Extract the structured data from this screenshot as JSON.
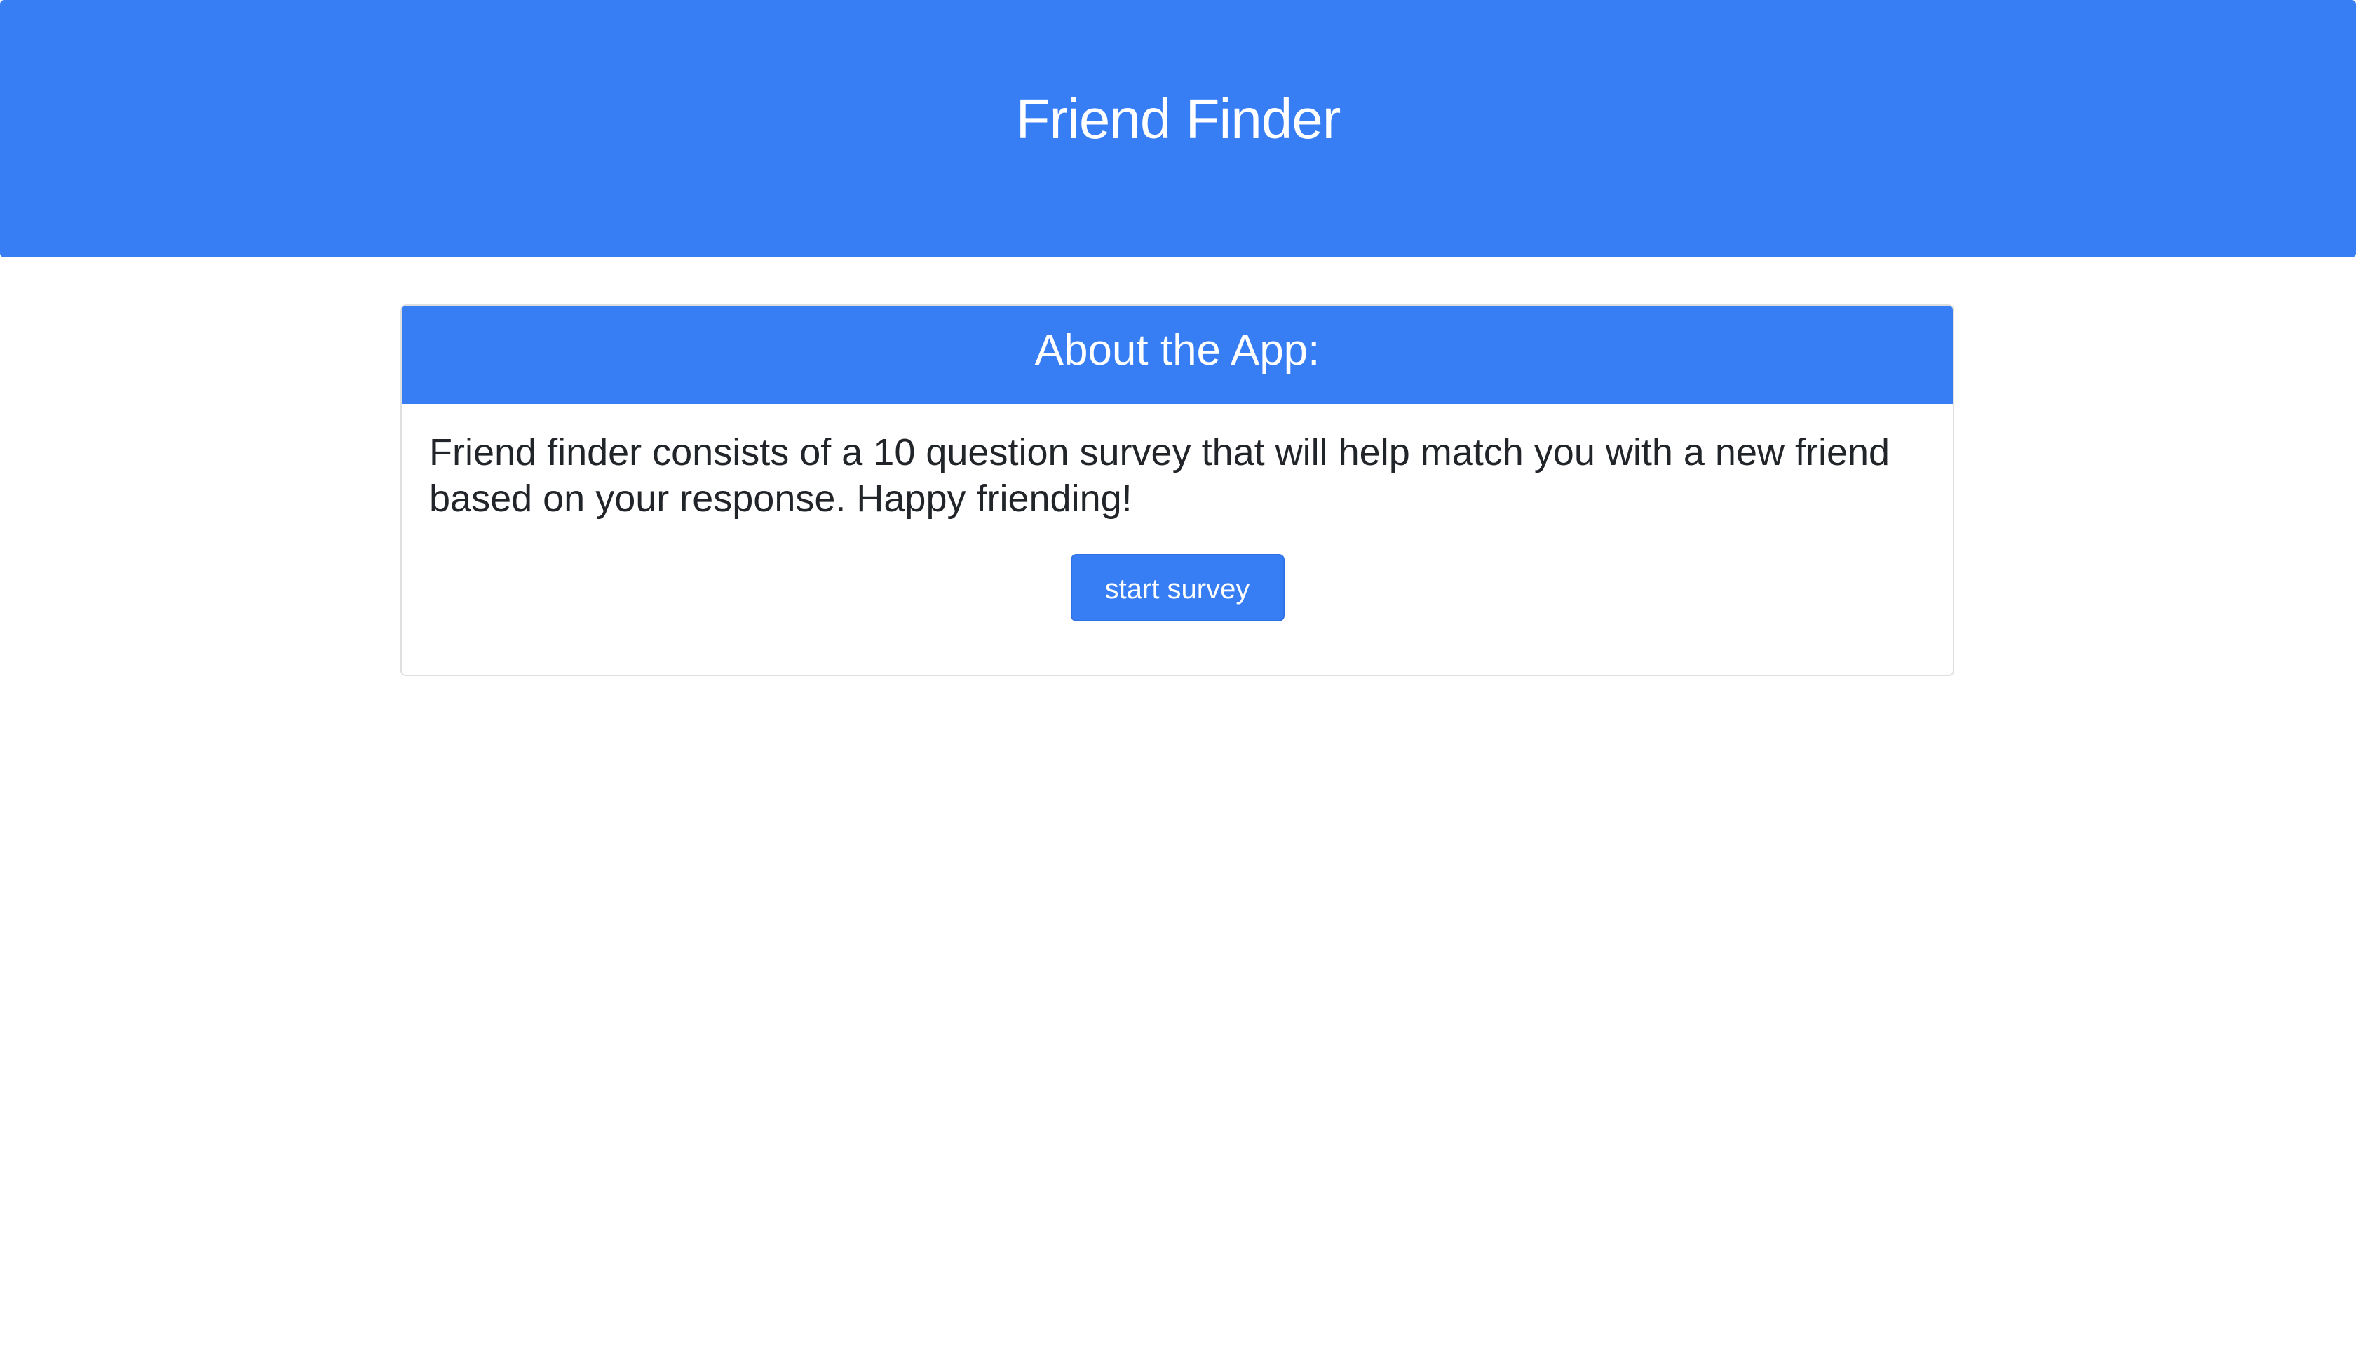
{
  "header": {
    "title": "Friend Finder"
  },
  "about_card": {
    "title": "About the App:",
    "description": "Friend finder consists of a 10 question survey that will help match you with a new friend based on your response. Happy friending!",
    "button_label": "start survey"
  },
  "colors": {
    "primary": "#377ef5",
    "text": "#212529",
    "background": "#ffffff",
    "card_border": "#dfdfdf"
  }
}
